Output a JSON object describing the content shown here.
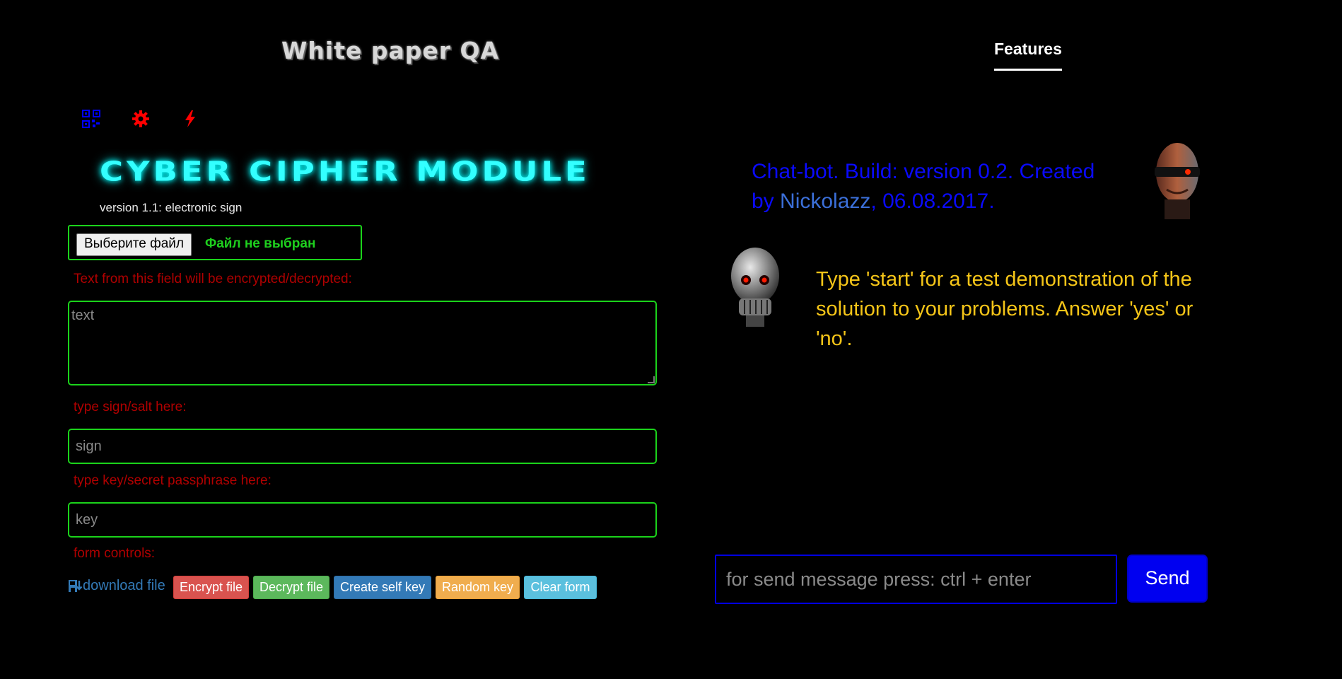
{
  "header": {
    "site_title": "White paper QA",
    "nav_features": "Features"
  },
  "toolbar": {
    "icons": [
      "qr-code-icon",
      "gear-icon",
      "lightning-icon"
    ],
    "colors": {
      "qr": "#0000ff",
      "gear": "#ff0000",
      "lightning": "#ff0000"
    }
  },
  "cipher": {
    "title": "Cyber Cipher Module",
    "version": "version 1.1: electronic sign",
    "file_button": "Выберите файл",
    "file_status": "Файл не выбран",
    "text_label": "Text from this field will be encrypted/decrypted:",
    "text_placeholder": "text",
    "sign_label": "type sign/salt here:",
    "sign_placeholder": "sign",
    "key_label": "type key/secret passphrase here:",
    "key_placeholder": "key",
    "controls_label": "form controls:",
    "download_link": "download file",
    "buttons": {
      "encrypt": "Encrypt file",
      "decrypt": "Decrypt file",
      "self_key": "Create self key",
      "random_key": "Random key",
      "clear": "Clear form"
    }
  },
  "chat": {
    "info_prefix": "Chat-bot. Build: version 0.2. Created by ",
    "author": "Nickolazz",
    "info_date": ", 06.08.2017.",
    "bot_message": "Type 'start' for a test demonstration of the solution to your problems. Answer 'yes' or 'no'.",
    "input_placeholder": "for send message press: ctrl + enter",
    "send_button": "Send"
  },
  "colors": {
    "background": "#000000",
    "accent_green": "#1bd31b",
    "label_red": "#b00000",
    "title_cyan": "#33ffff",
    "chat_blue": "#0000f0",
    "bot_yellow": "#f5c518"
  }
}
